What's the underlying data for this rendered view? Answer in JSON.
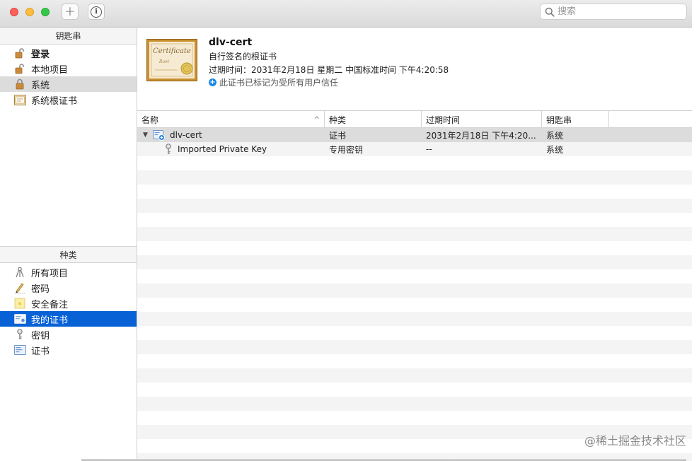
{
  "toolbar": {
    "add_symbol": "+",
    "info_symbol": "i",
    "search_placeholder": "搜索"
  },
  "sidebar": {
    "keychains_header": "钥匙串",
    "keychains": [
      {
        "label": "登录",
        "icon": "lock-open-icon"
      },
      {
        "label": "本地项目",
        "icon": "lock-open-icon"
      },
      {
        "label": "系统",
        "icon": "lock-closed-icon"
      },
      {
        "label": "系统根证书",
        "icon": "cabinet-icon"
      }
    ],
    "categories_header": "种类",
    "categories": [
      {
        "label": "所有项目",
        "icon": "all-items-icon"
      },
      {
        "label": "密码",
        "icon": "password-pencil-icon"
      },
      {
        "label": "安全备注",
        "icon": "note-icon"
      },
      {
        "label": "我的证书",
        "icon": "my-certificate-icon"
      },
      {
        "label": "密钥",
        "icon": "key-icon"
      },
      {
        "label": "证书",
        "icon": "certificate-icon"
      }
    ]
  },
  "certificate": {
    "image_text": "Certificate",
    "image_subtext": "Root",
    "name": "dlv-cert",
    "subtitle": "自行签名的根证书",
    "expiry": "过期时间：2031年2月18日 星期二 中国标准时间 下午4:20:58",
    "trust": "此证书已标记为受所有用户信任",
    "trust_symbol": "+"
  },
  "table": {
    "columns": {
      "name": "名称",
      "kind": "种类",
      "expires": "过期时间",
      "keychain": "钥匙串",
      "sort_indicator": "^"
    },
    "rows": [
      {
        "name": "dlv-cert",
        "kind": "证书",
        "expires": "2031年2月18日 下午4:20...",
        "keychain": "系统",
        "disclosure": "▼"
      },
      {
        "name": "Imported Private Key",
        "kind": "专用密钥",
        "expires": "--",
        "keychain": "系统"
      }
    ]
  },
  "watermark": "@稀土掘金技术社区",
  "colors": {
    "selection_blue": "#0862d6",
    "selection_gray": "#dcdcdc",
    "trust_blue": "#1a89e8"
  }
}
